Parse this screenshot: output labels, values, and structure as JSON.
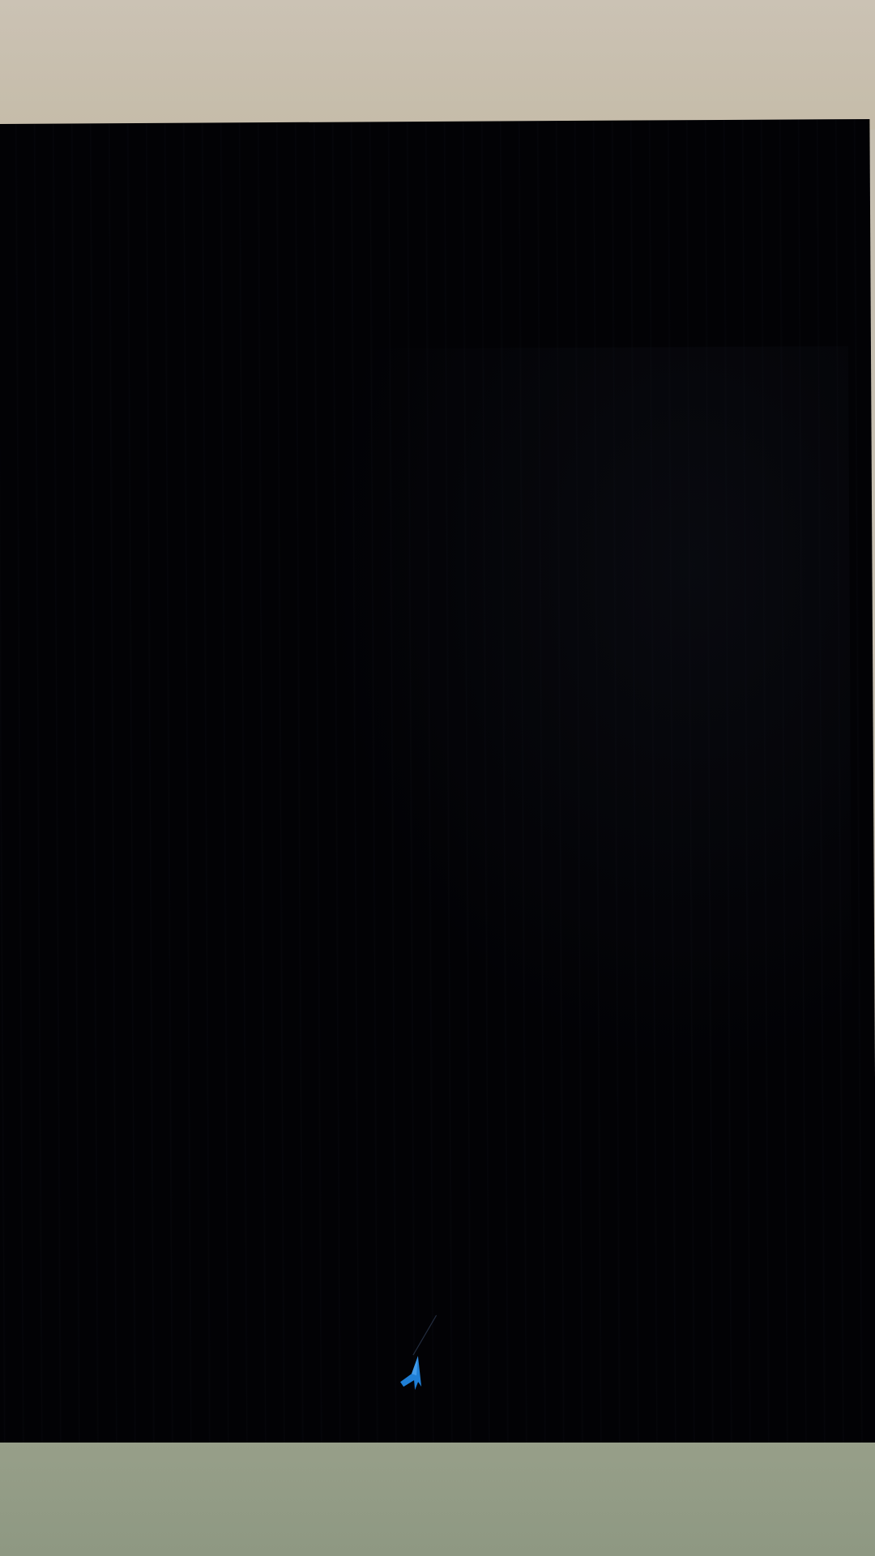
{
  "scene": {
    "background_color": "#020205",
    "top_band_color": "#c8bfb0",
    "bottom_band_color": "#929c86"
  },
  "player": {
    "icon": "player-ship-icon",
    "color": "#1f7fd6"
  }
}
